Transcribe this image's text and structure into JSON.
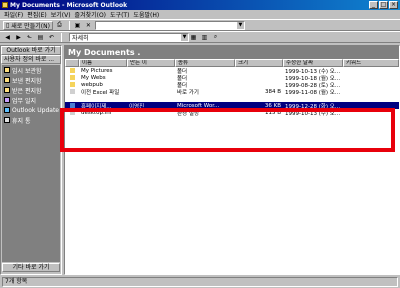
{
  "window": {
    "title": "My Documents - Microsoft Outlook"
  },
  "menu": [
    "파일(F)",
    "편집(E)",
    "보기(V)",
    "즐겨찾기(O)",
    "도구(T)",
    "도움말(H)"
  ],
  "toolbar1": {
    "new_label": "새로 만들기(N)",
    "combo_value": ""
  },
  "toolbar2": {
    "view_value": "자세히"
  },
  "sidebar": {
    "header": "Outlook 바로 가기",
    "group": "사용자 정의 바로 ...",
    "items": [
      "임시 보관함",
      "보낸 편지함",
      "받은 편지함",
      "업무 일지",
      "Outlook Update",
      "휴지 통"
    ],
    "footer": "기타 바로 가기"
  },
  "pane": {
    "title": "My Documents .",
    "columns": [
      "이름",
      "만든 이",
      "종류",
      "크기",
      "수정한 날짜",
      "키워드"
    ],
    "rows": [
      {
        "name": "My Pictures",
        "author": "",
        "type": "폴더",
        "size": "",
        "date": "1999-10-13 (수) 오...",
        "selected": false
      },
      {
        "name": "My Webs",
        "author": "",
        "type": "폴더",
        "size": "",
        "date": "1999-10-18 (월) 오...",
        "selected": false
      },
      {
        "name": "webpub",
        "author": "",
        "type": "폴더",
        "size": "",
        "date": "1999-08-28 (토) 오...",
        "selected": false
      },
      {
        "name": "이전 Excel 파일",
        "author": "",
        "type": "바로 가기",
        "size": "384 B",
        "date": "1999-11-08 (월) 오...",
        "selected": false
      },
      {
        "name": "",
        "author": "",
        "type": "",
        "size": "",
        "date": "",
        "selected": false
      },
      {
        "name": "홍페이지제...",
        "author": "이영진",
        "type": "Microsoft Wor...",
        "size": "36 KB",
        "date": "1999-12-28 (화) 오...",
        "selected": true
      },
      {
        "name": "desktop.ini",
        "author": "",
        "type": "환경 설정",
        "size": "115 B",
        "date": "1999-10-13 (수) 오...",
        "selected": false
      }
    ]
  },
  "status": {
    "count": "7개 항목"
  },
  "colors": {
    "title_bar": "#000080",
    "highlight": "#e8000b",
    "selection": "#000080"
  }
}
